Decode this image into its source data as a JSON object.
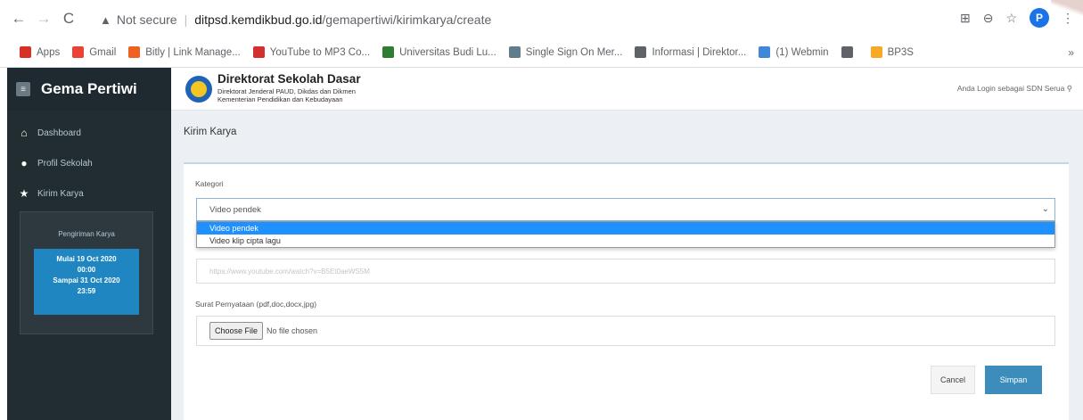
{
  "browser": {
    "back_icon": "arrow-left-icon",
    "forward_icon": "arrow-right-icon",
    "reload_icon": "reload-icon",
    "security_label": "Not secure",
    "url_host": "ditpsd.kemdikbud.go.id",
    "url_path": "/gemapertiwi/kirimkarya/create",
    "profile_initial": "P",
    "bookmarks": [
      {
        "label": "Apps",
        "color": "#d93025"
      },
      {
        "label": "Gmail",
        "color": "#ea4335"
      },
      {
        "label": "Bitly | Link Manage...",
        "color": "#ee6123"
      },
      {
        "label": "YouTube to MP3 Co...",
        "color": "#d32f2f"
      },
      {
        "label": "Universitas Budi Lu...",
        "color": "#2e7d32"
      },
      {
        "label": "Single Sign On Mer...",
        "color": "#607d8b"
      },
      {
        "label": "Informasi | Direktor...",
        "color": "#5f6368"
      },
      {
        "label": "(1) Webmin",
        "color": "#3f87d9"
      },
      {
        "label": "",
        "color": "#5f6368"
      },
      {
        "label": "BP3S",
        "color": "#f9a825"
      }
    ],
    "more_label": "»"
  },
  "sidebar": {
    "brand": "Gema Pertiwi",
    "items": [
      {
        "label": "Dashboard",
        "icon": "home-icon"
      },
      {
        "label": "Profil Sekolah",
        "icon": "user-icon"
      },
      {
        "label": "Kirim Karya",
        "icon": "star-icon"
      }
    ],
    "schedule": {
      "title": "Pengiriman Karya",
      "line1": "Mulai 19 Oct 2020",
      "line2": "00:00",
      "line3": "Sampai 31 Oct 2020",
      "line4": "23:59"
    }
  },
  "header": {
    "org_title": "Direktorat Sekolah Dasar",
    "org_sub1": "Direktorat Jenderal PAUD, Dikdas dan Dikmen",
    "org_sub2": "Kementerian Pendidikan dan Kebudayaan",
    "login_info": "Anda Login sebagai SDN Serua"
  },
  "main": {
    "page_title": "Kirim Karya",
    "form": {
      "kategori_label": "Kategori",
      "kategori_value": "Video pendek",
      "kategori_options": [
        "Video pendek",
        "Video klip cipta lagu"
      ],
      "link_placeholder": "https://www.youtube.com/watch?v=B5Et0aeWS5M",
      "surat_label": "Surat Pernyataan (pdf,doc,docx,jpg)",
      "choose_file_label": "Choose File",
      "no_file_label": "No file chosen",
      "cancel_label": "Cancel",
      "save_label": "Simpan"
    }
  }
}
